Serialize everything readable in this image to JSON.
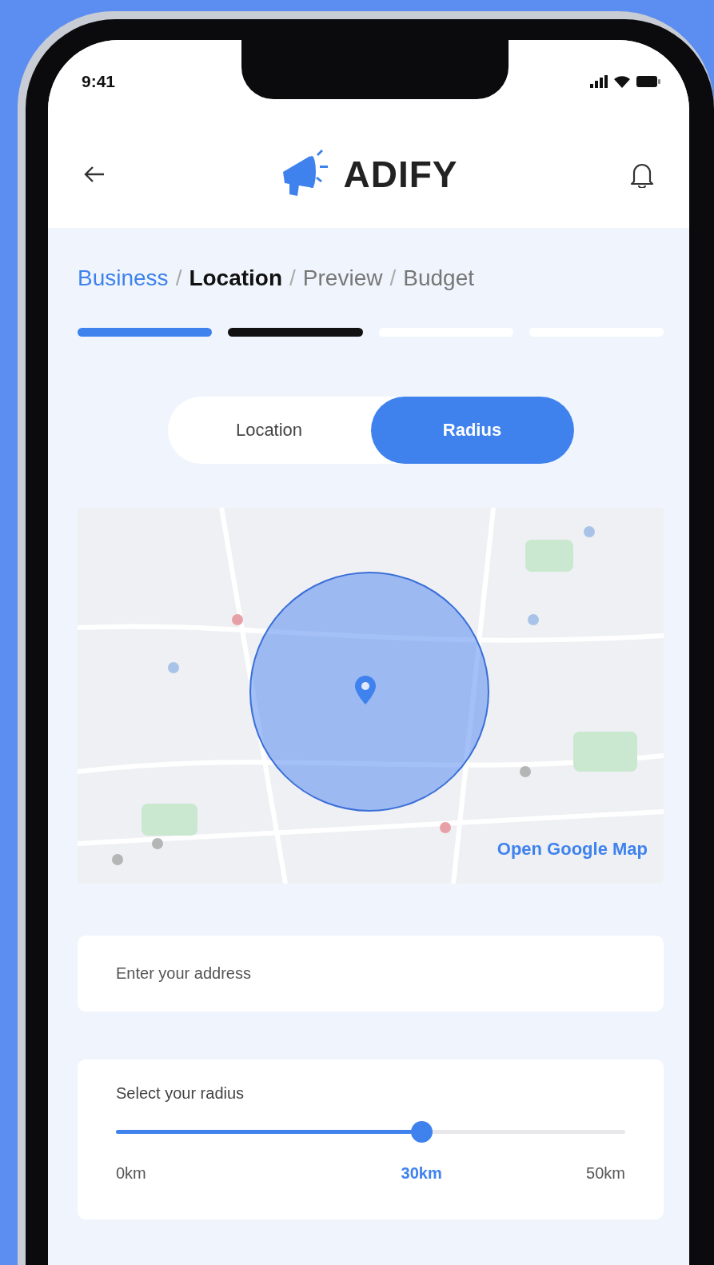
{
  "status_bar": {
    "time": "9:41"
  },
  "header": {
    "brand": "ADIFY"
  },
  "steps": [
    {
      "label": "Business",
      "completed": true,
      "selected": false
    },
    {
      "label": "Location",
      "completed": false,
      "selected": true
    },
    {
      "label": "Preview",
      "completed": false,
      "selected": false
    },
    {
      "label": "Budget",
      "completed": false,
      "selected": false
    }
  ],
  "step_separators": [
    "/",
    "/",
    "/"
  ],
  "tabs": [
    {
      "label": "Location",
      "selected": false
    },
    {
      "label": "Radius",
      "selected": true
    }
  ],
  "map": {
    "link": "Open Google Map"
  },
  "address": {
    "placeholder": "Enter your address"
  },
  "radius": {
    "label": "Select your radius",
    "level": 0.6,
    "min_label": "0km",
    "value_label": "30km",
    "max_label": "50km"
  }
}
